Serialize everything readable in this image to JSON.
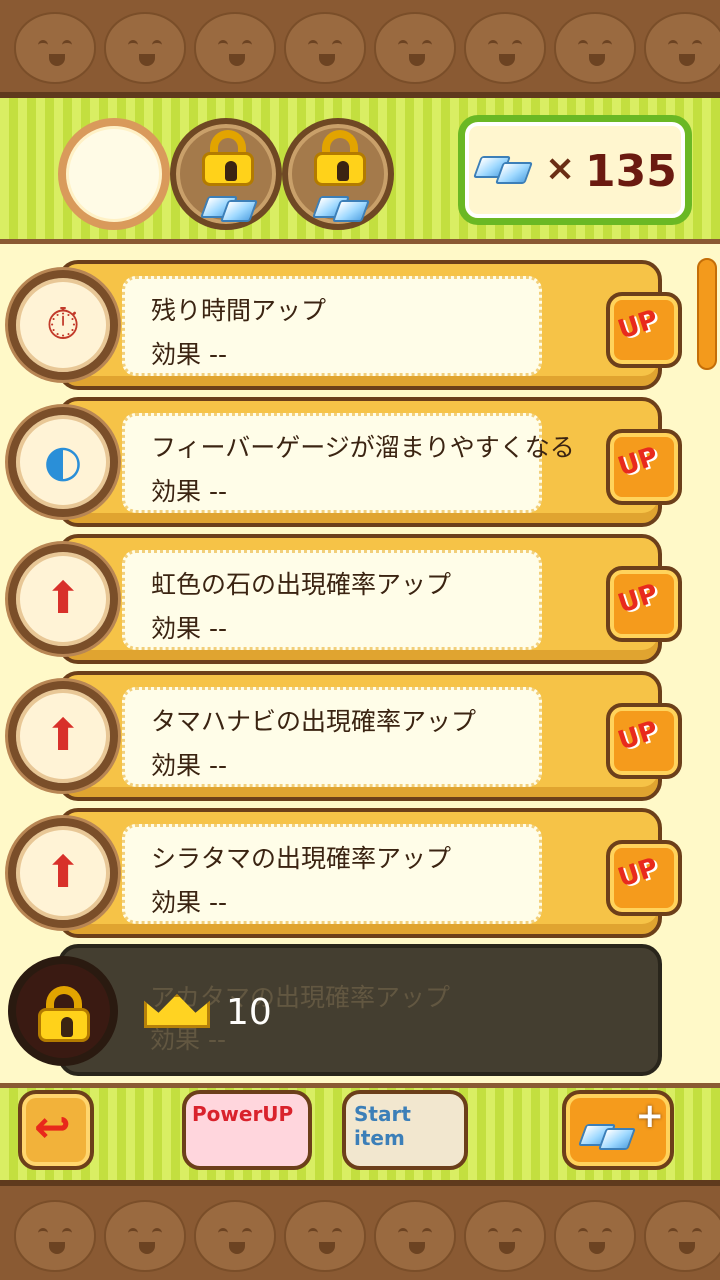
{
  "currency": {
    "icon": "diamond-icon",
    "times": "×",
    "amount": "135"
  },
  "slots": [
    {
      "state": "empty"
    },
    {
      "state": "locked",
      "icon": "lock-icon"
    },
    {
      "state": "locked",
      "icon": "lock-icon"
    }
  ],
  "upgrades": [
    {
      "icon": "stopwatch-plus-icon",
      "title": "残り時間アップ",
      "effect": "効果 --",
      "button": "UP"
    },
    {
      "icon": "fever-gauge-plus-icon",
      "title": "フィーバーゲージが溜まりやすくなる",
      "effect": "効果 --",
      "button": "UP"
    },
    {
      "icon": "rainbow-stone-up-icon",
      "title": "虹色の石の出現確率アップ",
      "effect": "効果 --",
      "button": "UP"
    },
    {
      "icon": "tamahanabi-up-icon",
      "title": "タマハナビの出現確率アップ",
      "effect": "効果 --",
      "button": "UP"
    },
    {
      "icon": "shiratama-up-icon",
      "title": "シラタマの出現確率アップ",
      "effect": "効果 --",
      "button": "UP"
    }
  ],
  "locked_upgrade": {
    "icon": "akatama-up-icon",
    "title": "アカタマの出現確率アップ",
    "effect": "効果 --",
    "required": "10"
  },
  "bottom_bar": {
    "power_up": "PowerUP",
    "start_item": "Start item"
  },
  "colors": {
    "accent_orange": "#f59b1c",
    "frame_brown": "#6c3f1a",
    "stripe_green": "#c3df3f",
    "card_gold": "#f6c347"
  }
}
